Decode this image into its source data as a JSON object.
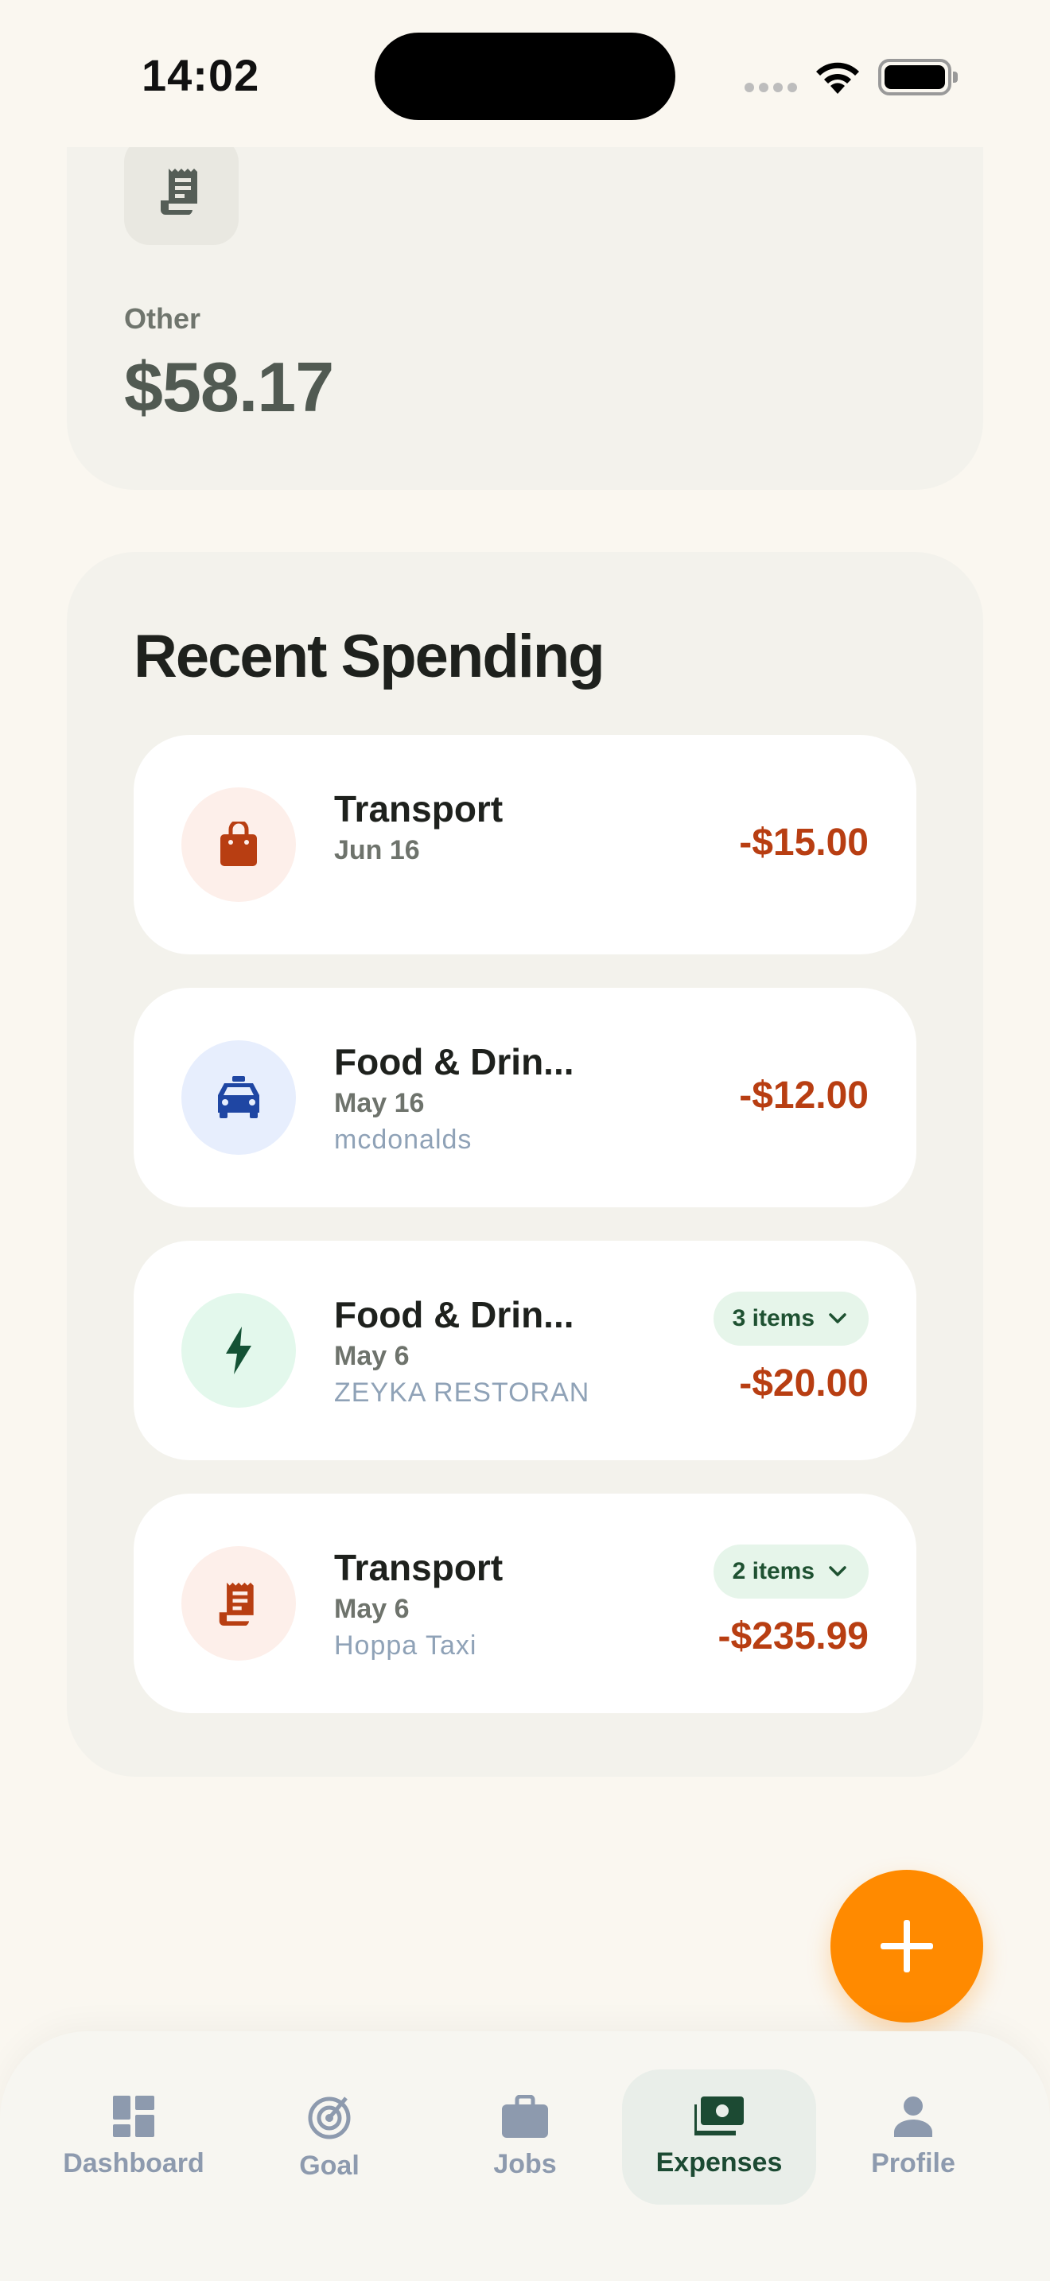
{
  "status_bar": {
    "time": "14:02"
  },
  "summary_card": {
    "label": "Other",
    "amount": "$58.17",
    "icon": "receipt-icon"
  },
  "recent": {
    "title": "Recent Spending",
    "transactions": [
      {
        "title": "Transport",
        "date": "Jun 16",
        "note": "",
        "amount": "-$15.00",
        "icon": "shopping-bag-icon",
        "icon_bg": "#FDEFEA",
        "icon_color": "#B83E12"
      },
      {
        "title": "Food & Drin...",
        "date": "May 16",
        "note": "mcdonalds",
        "amount": "-$12.00",
        "icon": "taxi-icon",
        "icon_bg": "#E7EEFD",
        "icon_color": "#1F46A3"
      },
      {
        "title": "Food & Drin...",
        "date": "May 6",
        "note": "ZEYKA RESTORAN",
        "amount": "-$20.00",
        "items_chip": "3 items",
        "icon": "bolt-icon",
        "icon_bg": "#E3F8EC",
        "icon_color": "#145235"
      },
      {
        "title": "Transport",
        "date": "May 6",
        "note": "Hoppa Taxi",
        "amount": "-$235.99",
        "items_chip": "2 items",
        "icon": "receipt-icon",
        "icon_bg": "#FDEFEA",
        "icon_color": "#B83E12"
      }
    ]
  },
  "fab": {
    "icon": "plus-icon",
    "color": "#FF8A00"
  },
  "nav": {
    "items": [
      {
        "label": "Dashboard",
        "icon": "dashboard-icon",
        "active": false
      },
      {
        "label": "Goal",
        "icon": "target-icon",
        "active": false
      },
      {
        "label": "Jobs",
        "icon": "briefcase-icon",
        "active": false
      },
      {
        "label": "Expenses",
        "icon": "cash-icon",
        "active": true
      },
      {
        "label": "Profile",
        "icon": "person-icon",
        "active": false
      }
    ]
  },
  "colors": {
    "background": "#FAF7F0",
    "card": "#F3F2EC",
    "negative_amount": "#B83E12",
    "active_nav": "#1C4A33",
    "inactive_nav": "#8D9AAE"
  }
}
